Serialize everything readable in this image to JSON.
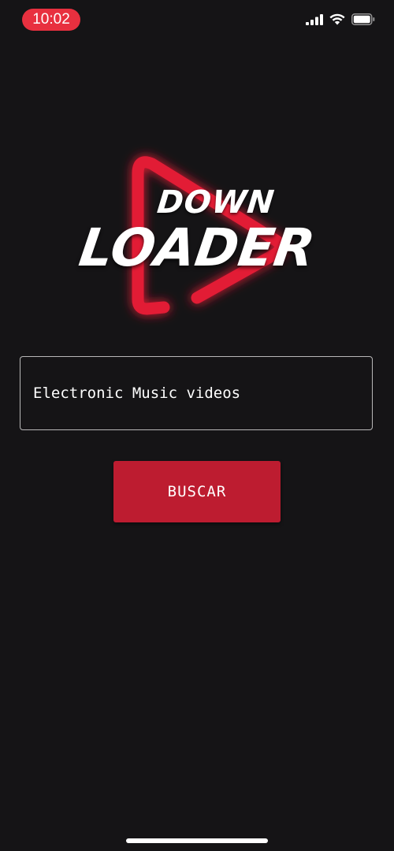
{
  "status_bar": {
    "time": "10:02",
    "icons": [
      "cellular-signal-icon",
      "wifi-icon",
      "battery-icon"
    ],
    "time_pill_color": "#e8303f"
  },
  "logo": {
    "lettering": "DOWN LOADER",
    "accent_color": "#e21b36"
  },
  "search": {
    "value": "Electronic Music videos"
  },
  "button": {
    "label": "BUSCAR",
    "color": "#bd1c30"
  },
  "theme": {
    "background": "#151416"
  }
}
